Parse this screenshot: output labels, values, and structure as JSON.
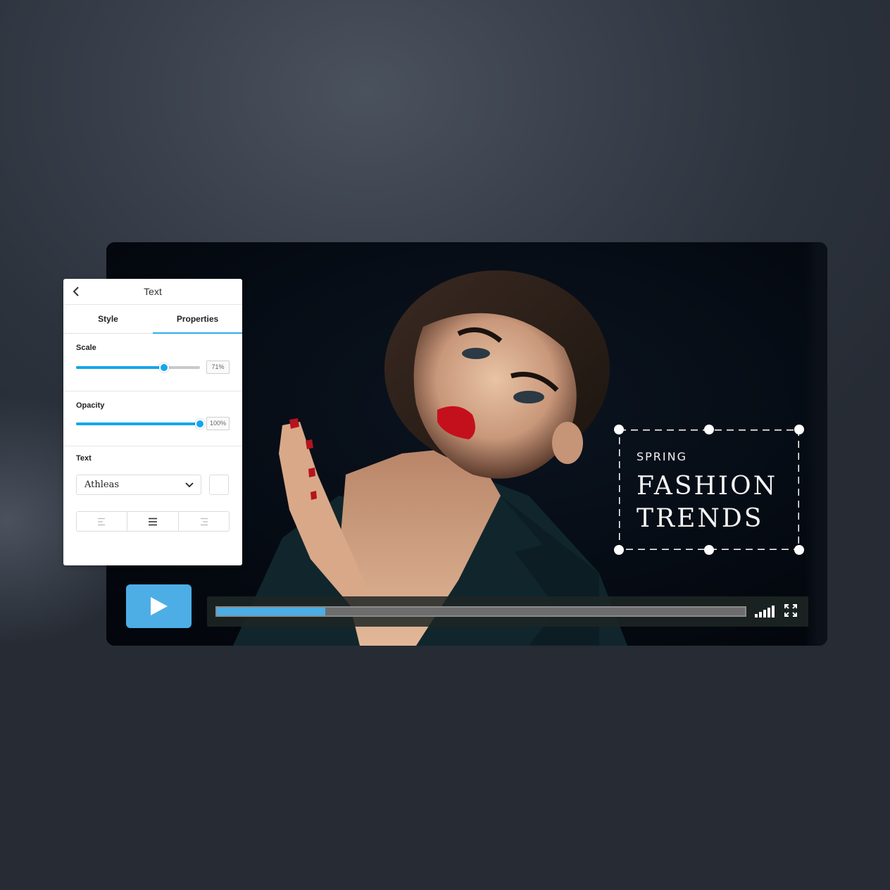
{
  "panel": {
    "title": "Text",
    "back_icon": "chevron-left-icon",
    "tabs": [
      {
        "label": "Style",
        "active": false
      },
      {
        "label": "Properties",
        "active": true
      }
    ],
    "scale": {
      "label": "Scale",
      "value_percent": 71,
      "display": "71%"
    },
    "opacity": {
      "label": "Opacity",
      "value_percent": 100,
      "display": "100%"
    },
    "text_section": {
      "label": "Text",
      "font": "Athleas",
      "font_dropdown_icon": "chevron-down-icon",
      "color_swatch": "#ffffff",
      "alignment": {
        "options": [
          "left",
          "center",
          "right"
        ],
        "selected": "center"
      }
    }
  },
  "video": {
    "overlay": {
      "line1": "SPRING",
      "line2": "FASHION",
      "line3": "TRENDS"
    },
    "controls": {
      "play_icon": "play-icon",
      "progress_fraction": 0.205,
      "volume_icon": "volume-bars-icon",
      "fullscreen_icon": "fullscreen-icon"
    }
  },
  "colors": {
    "accent": "#14a6ec",
    "play_button": "#4daee6",
    "progress_fill": "#4aaee6"
  }
}
